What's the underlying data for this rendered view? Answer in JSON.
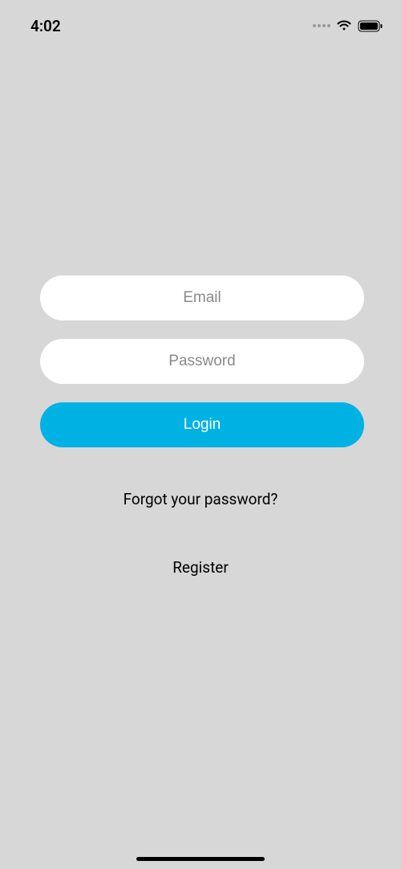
{
  "status_bar": {
    "time": "4:02"
  },
  "form": {
    "email_placeholder": "Email",
    "password_placeholder": "Password",
    "login_button_label": "Login",
    "forgot_password_label": "Forgot your password?",
    "register_label": "Register"
  }
}
